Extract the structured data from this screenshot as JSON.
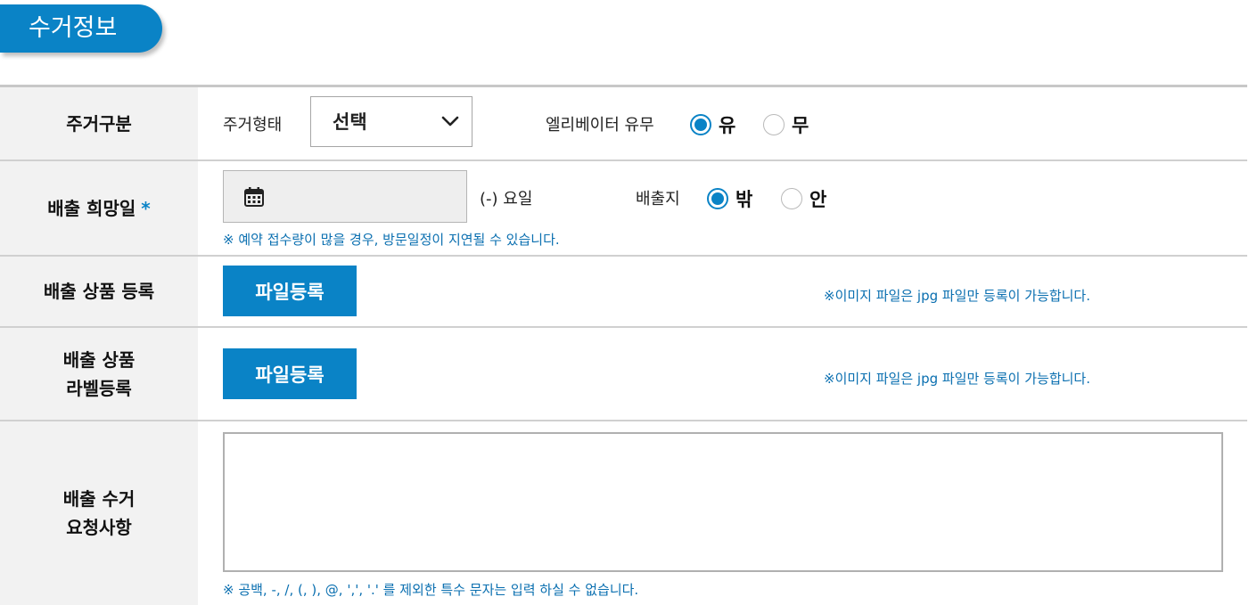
{
  "section": {
    "title": "수거정보"
  },
  "rows": {
    "housing": {
      "label": "주거구분",
      "type_label": "주거형태",
      "select_value": "선택",
      "elevator_label": "엘리베이터 유무",
      "options": [
        "유",
        "무"
      ],
      "selected": "유"
    },
    "date": {
      "label": "배출 희망일",
      "required_mark": "*",
      "weekday_text": "(-) 요일",
      "location_label": "배출지",
      "options": [
        "밖",
        "안"
      ],
      "selected": "밖",
      "note": "※ 예약 접수량이 많을 경우, 방문일정이 지연될 수 있습니다."
    },
    "product": {
      "label": "배출 상품 등록",
      "button": "파일등록",
      "note": "※이미지 파일은 jpg 파일만 등록이 가능합니다."
    },
    "label_reg": {
      "label_line1": "배출 상품",
      "label_line2": "라벨등록",
      "button": "파일등록",
      "note": "※이미지 파일은 jpg 파일만 등록이 가능합니다."
    },
    "request": {
      "label_line1": "배출 수거",
      "label_line2": "요청사항",
      "value": "",
      "note": "※ 공백, -, /, (, ), @, ',', '.' 를 제외한 특수 문자는 입력 하실 수 없습니다."
    }
  },
  "colors": {
    "accent": "#0a83c6",
    "header_bg": "#f2f2f2",
    "note": "#0a6fb0"
  },
  "icons": {
    "date": "calendar-icon",
    "select": "chevron-down-icon"
  }
}
